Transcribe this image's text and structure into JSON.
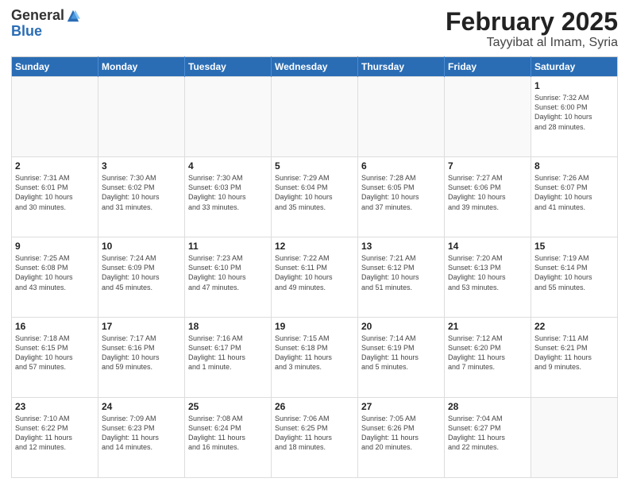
{
  "header": {
    "logo_general": "General",
    "logo_blue": "Blue",
    "title": "February 2025",
    "subtitle": "Tayyibat al Imam, Syria"
  },
  "days_of_week": [
    "Sunday",
    "Monday",
    "Tuesday",
    "Wednesday",
    "Thursday",
    "Friday",
    "Saturday"
  ],
  "weeks": [
    [
      {
        "day": "",
        "info": ""
      },
      {
        "day": "",
        "info": ""
      },
      {
        "day": "",
        "info": ""
      },
      {
        "day": "",
        "info": ""
      },
      {
        "day": "",
        "info": ""
      },
      {
        "day": "",
        "info": ""
      },
      {
        "day": "1",
        "info": "Sunrise: 7:32 AM\nSunset: 6:00 PM\nDaylight: 10 hours\nand 28 minutes."
      }
    ],
    [
      {
        "day": "2",
        "info": "Sunrise: 7:31 AM\nSunset: 6:01 PM\nDaylight: 10 hours\nand 30 minutes."
      },
      {
        "day": "3",
        "info": "Sunrise: 7:30 AM\nSunset: 6:02 PM\nDaylight: 10 hours\nand 31 minutes."
      },
      {
        "day": "4",
        "info": "Sunrise: 7:30 AM\nSunset: 6:03 PM\nDaylight: 10 hours\nand 33 minutes."
      },
      {
        "day": "5",
        "info": "Sunrise: 7:29 AM\nSunset: 6:04 PM\nDaylight: 10 hours\nand 35 minutes."
      },
      {
        "day": "6",
        "info": "Sunrise: 7:28 AM\nSunset: 6:05 PM\nDaylight: 10 hours\nand 37 minutes."
      },
      {
        "day": "7",
        "info": "Sunrise: 7:27 AM\nSunset: 6:06 PM\nDaylight: 10 hours\nand 39 minutes."
      },
      {
        "day": "8",
        "info": "Sunrise: 7:26 AM\nSunset: 6:07 PM\nDaylight: 10 hours\nand 41 minutes."
      }
    ],
    [
      {
        "day": "9",
        "info": "Sunrise: 7:25 AM\nSunset: 6:08 PM\nDaylight: 10 hours\nand 43 minutes."
      },
      {
        "day": "10",
        "info": "Sunrise: 7:24 AM\nSunset: 6:09 PM\nDaylight: 10 hours\nand 45 minutes."
      },
      {
        "day": "11",
        "info": "Sunrise: 7:23 AM\nSunset: 6:10 PM\nDaylight: 10 hours\nand 47 minutes."
      },
      {
        "day": "12",
        "info": "Sunrise: 7:22 AM\nSunset: 6:11 PM\nDaylight: 10 hours\nand 49 minutes."
      },
      {
        "day": "13",
        "info": "Sunrise: 7:21 AM\nSunset: 6:12 PM\nDaylight: 10 hours\nand 51 minutes."
      },
      {
        "day": "14",
        "info": "Sunrise: 7:20 AM\nSunset: 6:13 PM\nDaylight: 10 hours\nand 53 minutes."
      },
      {
        "day": "15",
        "info": "Sunrise: 7:19 AM\nSunset: 6:14 PM\nDaylight: 10 hours\nand 55 minutes."
      }
    ],
    [
      {
        "day": "16",
        "info": "Sunrise: 7:18 AM\nSunset: 6:15 PM\nDaylight: 10 hours\nand 57 minutes."
      },
      {
        "day": "17",
        "info": "Sunrise: 7:17 AM\nSunset: 6:16 PM\nDaylight: 10 hours\nand 59 minutes."
      },
      {
        "day": "18",
        "info": "Sunrise: 7:16 AM\nSunset: 6:17 PM\nDaylight: 11 hours\nand 1 minute."
      },
      {
        "day": "19",
        "info": "Sunrise: 7:15 AM\nSunset: 6:18 PM\nDaylight: 11 hours\nand 3 minutes."
      },
      {
        "day": "20",
        "info": "Sunrise: 7:14 AM\nSunset: 6:19 PM\nDaylight: 11 hours\nand 5 minutes."
      },
      {
        "day": "21",
        "info": "Sunrise: 7:12 AM\nSunset: 6:20 PM\nDaylight: 11 hours\nand 7 minutes."
      },
      {
        "day": "22",
        "info": "Sunrise: 7:11 AM\nSunset: 6:21 PM\nDaylight: 11 hours\nand 9 minutes."
      }
    ],
    [
      {
        "day": "23",
        "info": "Sunrise: 7:10 AM\nSunset: 6:22 PM\nDaylight: 11 hours\nand 12 minutes."
      },
      {
        "day": "24",
        "info": "Sunrise: 7:09 AM\nSunset: 6:23 PM\nDaylight: 11 hours\nand 14 minutes."
      },
      {
        "day": "25",
        "info": "Sunrise: 7:08 AM\nSunset: 6:24 PM\nDaylight: 11 hours\nand 16 minutes."
      },
      {
        "day": "26",
        "info": "Sunrise: 7:06 AM\nSunset: 6:25 PM\nDaylight: 11 hours\nand 18 minutes."
      },
      {
        "day": "27",
        "info": "Sunrise: 7:05 AM\nSunset: 6:26 PM\nDaylight: 11 hours\nand 20 minutes."
      },
      {
        "day": "28",
        "info": "Sunrise: 7:04 AM\nSunset: 6:27 PM\nDaylight: 11 hours\nand 22 minutes."
      },
      {
        "day": "",
        "info": ""
      }
    ]
  ]
}
